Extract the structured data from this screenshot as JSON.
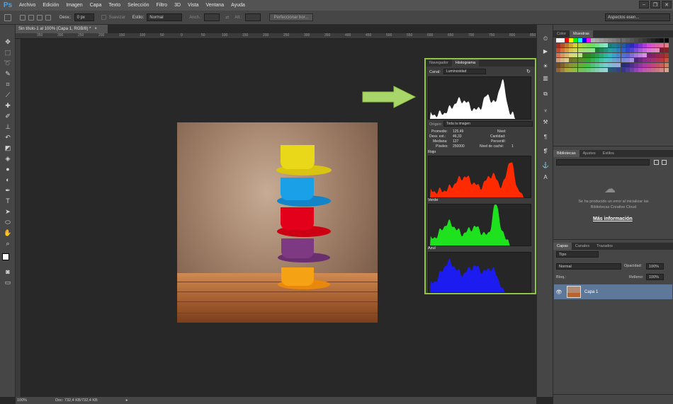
{
  "menubar": {
    "logo": "Ps",
    "items": [
      "Archivo",
      "Edición",
      "Imagen",
      "Capa",
      "Texto",
      "Selección",
      "Filtro",
      "3D",
      "Vista",
      "Ventana",
      "Ayuda"
    ],
    "window_controls": [
      "–",
      "❐",
      "✕"
    ]
  },
  "options": {
    "desv_label": "Desv.:",
    "desv_value": "0 px",
    "suavizar": "Suavizar",
    "estilo_label": "Estilo:",
    "estilo_value": "Normal",
    "anch_label": "Anch.:",
    "alt_label": "Alt.:",
    "refine_button": "Perfeccionar bor...",
    "workspace": "Aspectos esen..."
  },
  "document": {
    "tab_title": "Sin título-1 al 100% (Capa 1, RGB/8) *",
    "tab_close": "×",
    "zoom": "100%",
    "doc_info": "Doc: 732,4 KB/732,4 KB",
    "ruler_top": [
      "350",
      "300",
      "250",
      "200",
      "150",
      "100",
      "50",
      "0",
      "50",
      "100",
      "150",
      "200",
      "250",
      "300",
      "350",
      "400",
      "450",
      "500",
      "550",
      "600",
      "650",
      "700",
      "750",
      "800",
      "850"
    ]
  },
  "histogram": {
    "tabs": [
      "Navegador",
      "Histograma"
    ],
    "canal_label": "Canal:",
    "canal_value": "Luminosidad",
    "origen_label": "Origen:",
    "origen_value": "Toda la imagen",
    "stats_left": [
      [
        "Promedio:",
        "125,49"
      ],
      [
        "Desv. est.:",
        "46,33"
      ],
      [
        "Mediana:",
        "127"
      ],
      [
        "Píxeles:",
        "250000"
      ]
    ],
    "stats_right": [
      [
        "Nivel:",
        ""
      ],
      [
        "Cantidad:",
        ""
      ],
      [
        "Percentil:",
        ""
      ],
      [
        "Nivel de caché:",
        "1"
      ]
    ],
    "channels": [
      {
        "name": "Rojo",
        "color": "#ff2a00"
      },
      {
        "name": "Verde",
        "color": "#1de21d"
      },
      {
        "name": "Azul",
        "color": "#1c1cf0"
      }
    ],
    "luminosity_color": "#ffffff",
    "highlight_color": "#8fc540"
  },
  "panels": {
    "top_tabs": [
      "Color",
      "Muestras"
    ],
    "lib_tabs": [
      "Bibliotecas",
      "Ajustes",
      "Estilos"
    ],
    "lib_error": "Se ha producido un error al inicializar las Bibliotecas Creative Cloud",
    "lib_link": "Más información",
    "layers_tabs": [
      "Capas",
      "Canales",
      "Trazados"
    ],
    "filter_value": "Tipo",
    "blend_value": "Normal",
    "opacity_label": "Opacidad:",
    "opacity_value": "100%",
    "lock_label": "Bloq.:",
    "fill_label": "Relleno:",
    "fill_value": "100%",
    "layer_name": "Capa 1"
  }
}
